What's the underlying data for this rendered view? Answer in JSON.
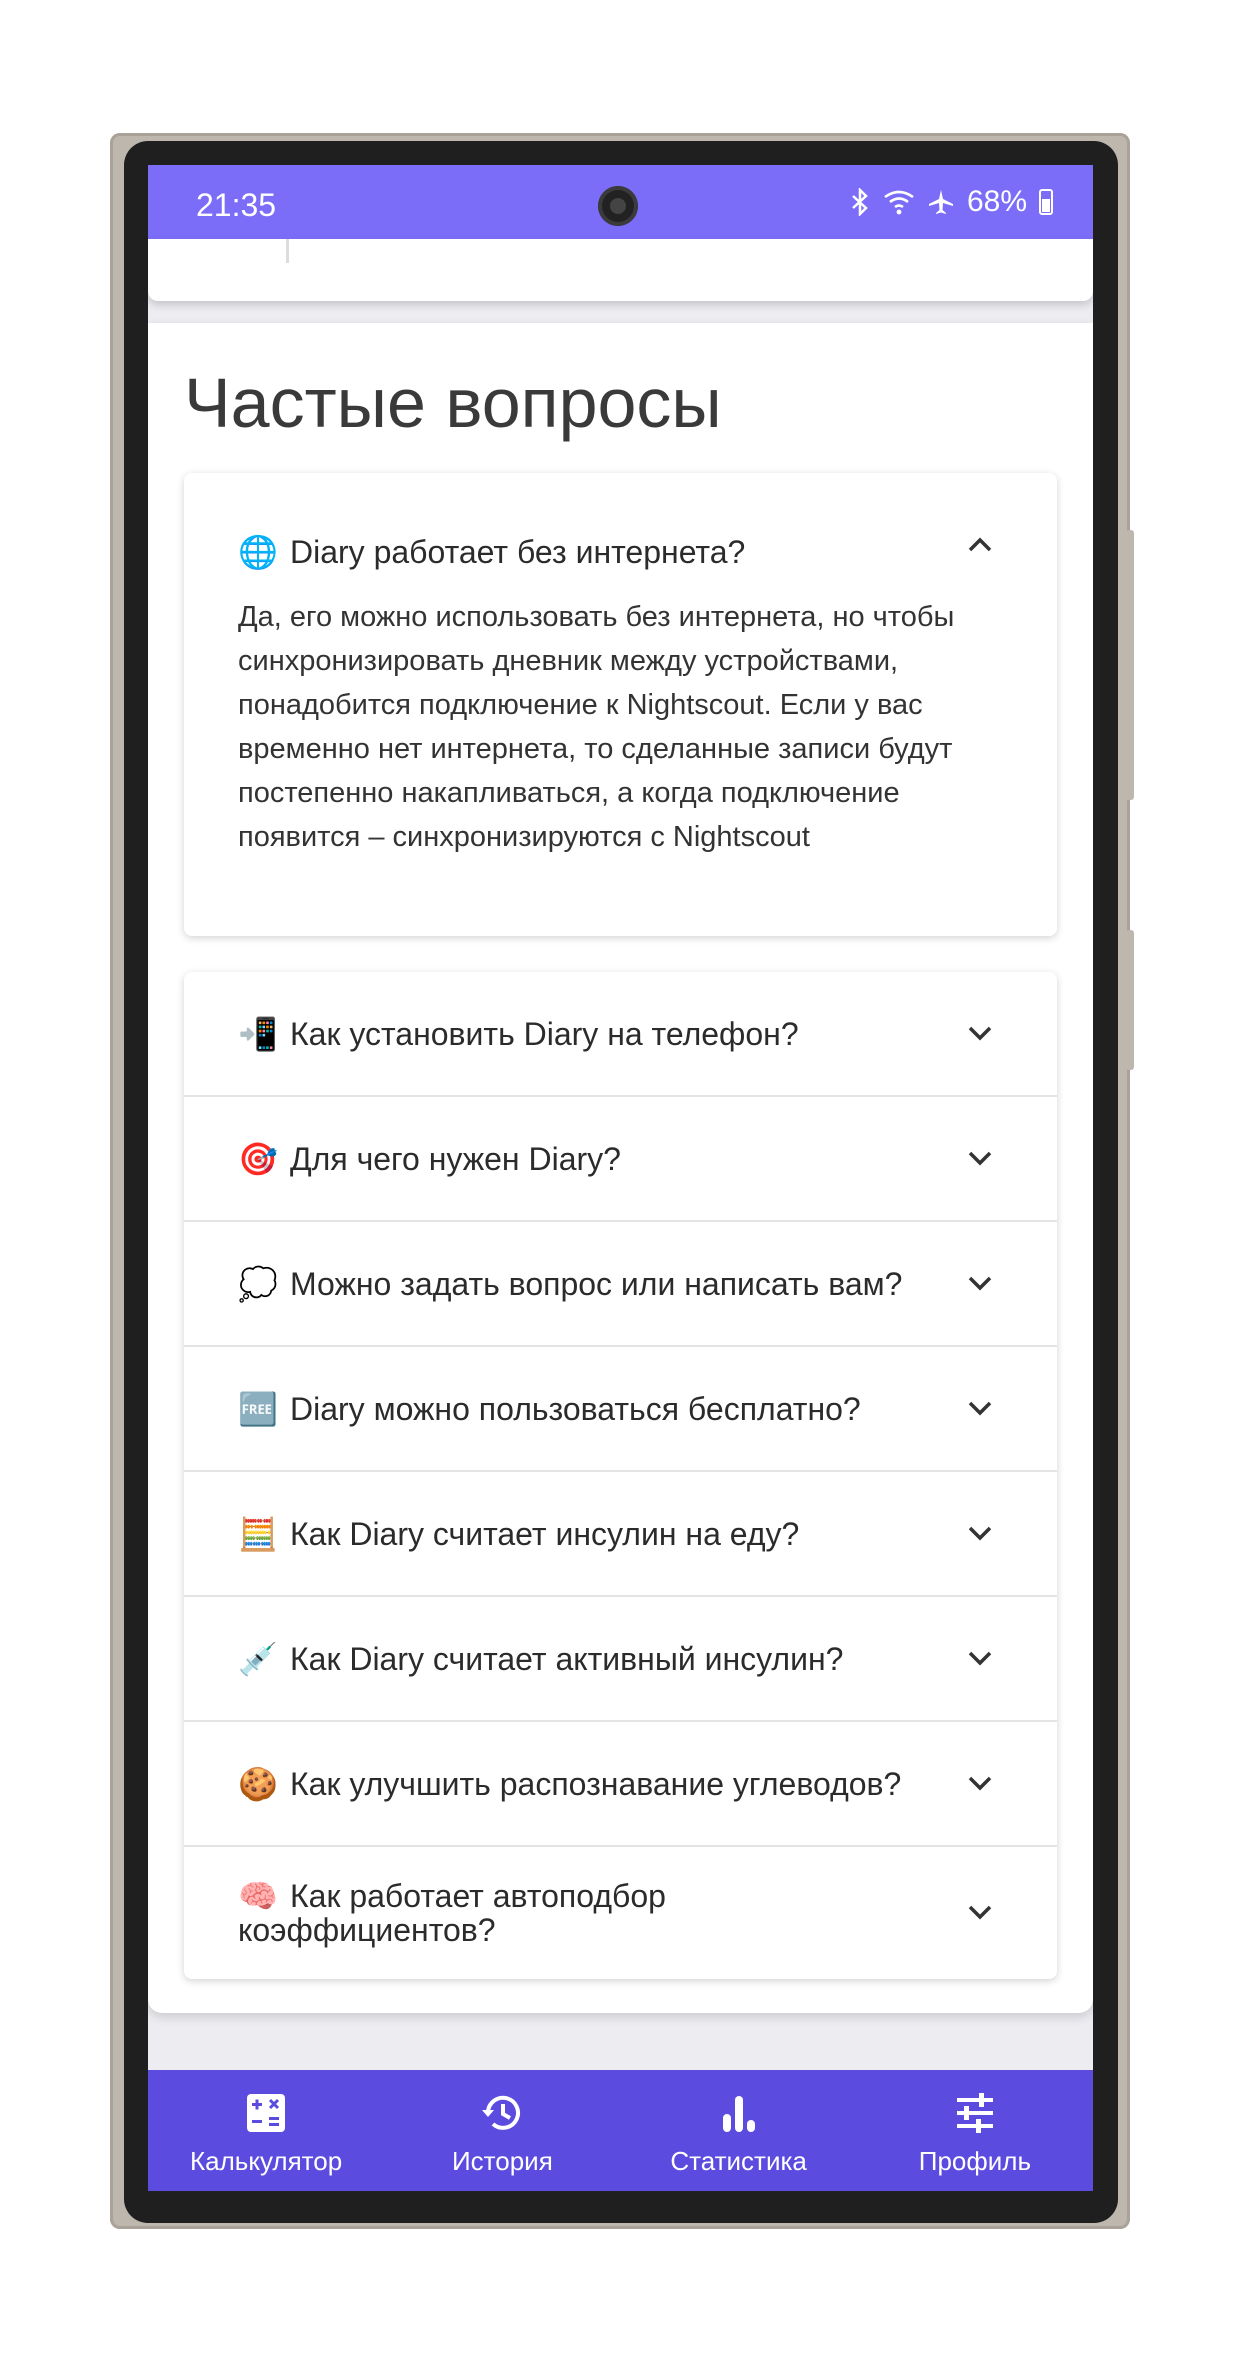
{
  "status": {
    "time": "21:35",
    "battery": "68%"
  },
  "faq": {
    "title": "Частые вопросы",
    "expanded": {
      "emoji": "🌐",
      "question": "Diary работает без интернета?",
      "answer": "Да, его можно использовать без интернета, но чтобы синхронизировать дневник между устройствами, понадобится подключение к Nightscout. Если у вас временно нет интернета, то сделанные записи будут постепенно накапливаться, а когда подключение появится – синхронизируются с Nightscout"
    },
    "items": [
      {
        "emoji": "📲",
        "question": "Как установить Diary на телефон?"
      },
      {
        "emoji": "🎯",
        "question": "Для чего нужен Diary?"
      },
      {
        "emoji": "💭",
        "question": "Можно задать вопрос или написать вам?"
      },
      {
        "emoji": "🆓",
        "question": "Diary можно пользоваться бесплатно?"
      },
      {
        "emoji": "🧮",
        "question": "Как Diary считает инсулин на еду?"
      },
      {
        "emoji": "💉",
        "question": "Как Diary считает активный инсулин?"
      },
      {
        "emoji": "🍪",
        "question": "Как улучшить распознавание углеводов?"
      },
      {
        "emoji": "🧠",
        "question": "Как работает автоподбор коэффициентов?"
      }
    ]
  },
  "nav": {
    "calculator": "Калькулятор",
    "history": "История",
    "stats": "Статистика",
    "profile": "Профиль"
  },
  "colors": {
    "status_bar": "#7b6df7",
    "nav_bar": "#5b4bdf"
  }
}
